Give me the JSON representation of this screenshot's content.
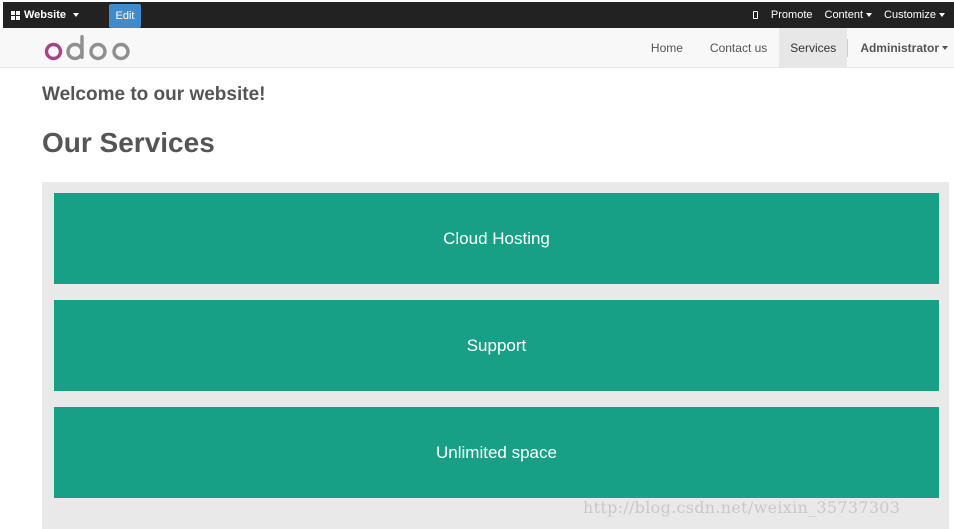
{
  "adminbar": {
    "website_label": "Website",
    "edit_label": "Edit",
    "promote_label": "Promote",
    "content_label": "Content",
    "customize_label": "Customize"
  },
  "navbar": {
    "logo_text": "odoo",
    "links": [
      {
        "label": "Home"
      },
      {
        "label": "Contact us"
      },
      {
        "label": "Services",
        "active": true
      }
    ],
    "user_label": "Administrator"
  },
  "page": {
    "welcome": "Welcome to our website!",
    "section_title": "Our Services",
    "services": [
      {
        "label": "Cloud Hosting"
      },
      {
        "label": "Support"
      },
      {
        "label": "Unlimited space"
      }
    ]
  },
  "watermark": "http://blog.csdn.net/weixin_35737303",
  "colors": {
    "adminbar_bg": "#222222",
    "edit_button": "#428bca",
    "service_card": "#17a085",
    "logo_purple": "#a24689",
    "logo_gray": "#8f8f8f"
  }
}
